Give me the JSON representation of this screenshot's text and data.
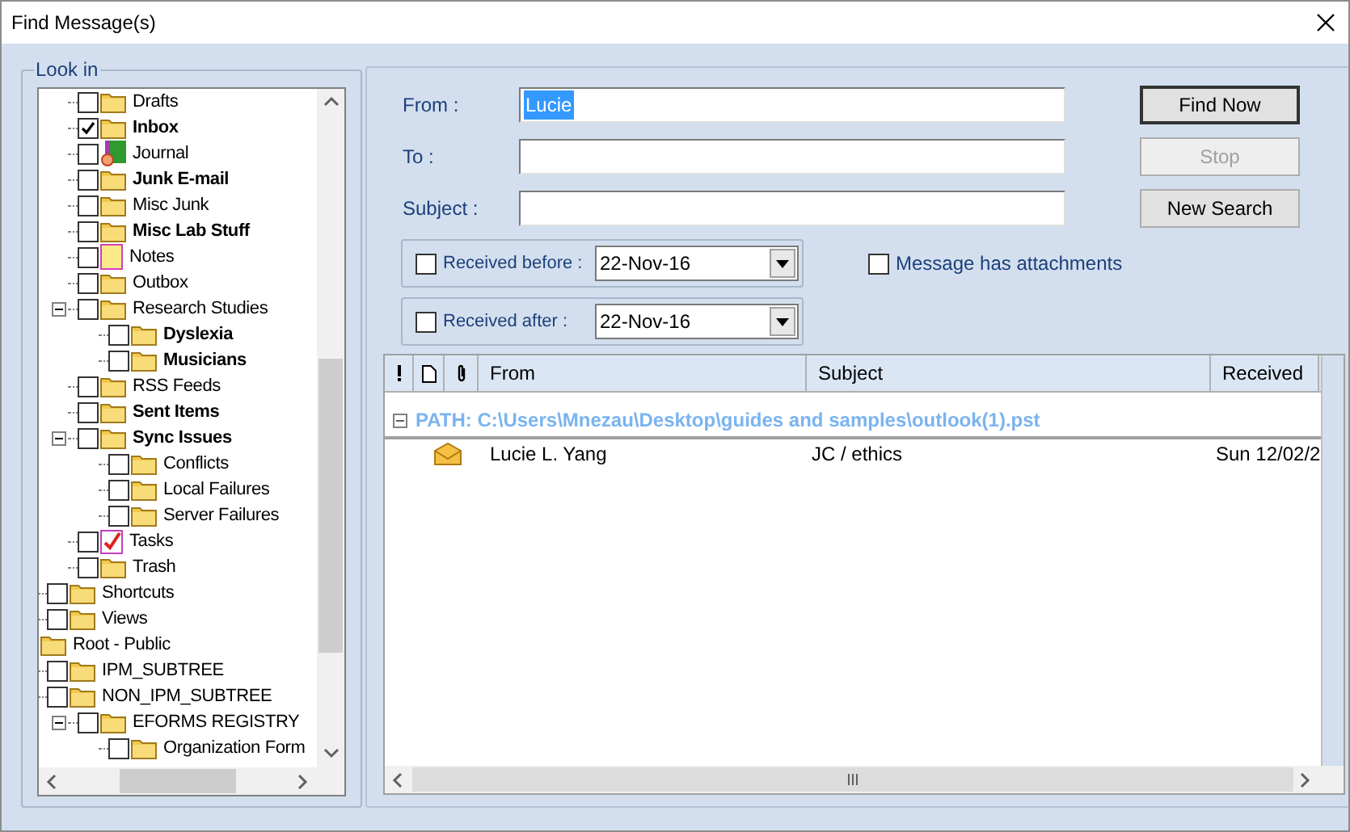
{
  "window": {
    "title": "Find Message(s)"
  },
  "look_in": {
    "label": "Look in",
    "tree": [
      {
        "children": [
          {
            "children": [
              {
                "label": "Drafts",
                "checkbox": true,
                "checked": false,
                "bold": false,
                "kind": "folder"
              },
              {
                "label": "Inbox",
                "checkbox": true,
                "checked": true,
                "bold": true,
                "kind": "folder"
              },
              {
                "label": "Journal",
                "checkbox": true,
                "checked": false,
                "bold": false,
                "kind": "journal"
              },
              {
                "label": "Junk E-mail",
                "checkbox": true,
                "checked": false,
                "bold": true,
                "kind": "folder"
              },
              {
                "label": "Misc Junk",
                "checkbox": true,
                "checked": false,
                "bold": false,
                "kind": "folder"
              },
              {
                "label": "Misc Lab Stuff",
                "checkbox": true,
                "checked": false,
                "bold": true,
                "kind": "folder"
              },
              {
                "label": "Notes",
                "checkbox": true,
                "checked": false,
                "bold": false,
                "kind": "notes"
              },
              {
                "label": "Outbox",
                "checkbox": true,
                "checked": false,
                "bold": false,
                "kind": "folder"
              },
              {
                "label": "Research Studies",
                "checkbox": true,
                "checked": false,
                "bold": false,
                "kind": "folder",
                "expanded": true,
                "children": [
                  {
                    "label": "Dyslexia",
                    "checkbox": true,
                    "checked": false,
                    "bold": true,
                    "kind": "folder"
                  },
                  {
                    "label": "Musicians",
                    "checkbox": true,
                    "checked": false,
                    "bold": true,
                    "kind": "folder"
                  }
                ]
              },
              {
                "label": "RSS Feeds",
                "checkbox": true,
                "checked": false,
                "bold": false,
                "kind": "folder"
              },
              {
                "label": "Sent Items",
                "checkbox": true,
                "checked": false,
                "bold": true,
                "kind": "folder"
              },
              {
                "label": "Sync Issues",
                "checkbox": true,
                "checked": false,
                "bold": true,
                "kind": "folder",
                "expanded": true,
                "children": [
                  {
                    "label": "Conflicts",
                    "checkbox": true,
                    "checked": false,
                    "bold": false,
                    "kind": "folder"
                  },
                  {
                    "label": "Local Failures",
                    "checkbox": true,
                    "checked": false,
                    "bold": false,
                    "kind": "folder"
                  },
                  {
                    "label": "Server Failures",
                    "checkbox": true,
                    "checked": false,
                    "bold": false,
                    "kind": "folder"
                  }
                ]
              },
              {
                "label": "Tasks",
                "checkbox": true,
                "checked": false,
                "bold": false,
                "kind": "tasks"
              },
              {
                "label": "Trash",
                "checkbox": true,
                "checked": false,
                "bold": false,
                "kind": "folder"
              }
            ]
          },
          {
            "label": "Shortcuts",
            "checkbox": true,
            "checked": false,
            "bold": false,
            "kind": "folder"
          },
          {
            "label": "Views",
            "checkbox": true,
            "checked": false,
            "bold": false,
            "kind": "folder"
          }
        ]
      },
      {
        "label": "Root - Public",
        "checkbox": false,
        "bold": false,
        "kind": "folder",
        "children": [
          {
            "label": "IPM_SUBTREE",
            "checkbox": true,
            "checked": false,
            "bold": false,
            "kind": "folder"
          },
          {
            "label": "NON_IPM_SUBTREE",
            "checkbox": true,
            "checked": false,
            "bold": false,
            "kind": "folder",
            "children": [
              {
                "label": "EFORMS REGISTRY",
                "checkbox": true,
                "checked": false,
                "bold": false,
                "kind": "folder",
                "expanded": true,
                "children": [
                  {
                    "label": "Organization Form",
                    "checkbox": true,
                    "checked": false,
                    "bold": false,
                    "kind": "folder"
                  }
                ]
              }
            ]
          }
        ]
      }
    ]
  },
  "fields": [
    {
      "label": "From :",
      "value": "Lucie",
      "selected": true
    },
    {
      "label": "To :"
    },
    {
      "label": "Subject :"
    }
  ],
  "buttons": [
    {
      "label": "Find Now",
      "disabled": false,
      "default": true
    },
    {
      "label": "Stop",
      "disabled": true,
      "default": false
    },
    {
      "label": "New Search",
      "disabled": false,
      "default": false
    }
  ],
  "date_filters": [
    {
      "label": "Received before :",
      "checked": false,
      "value": "22-Nov-16"
    },
    {
      "label": "Received after :",
      "checked": false,
      "value": "22-Nov-16"
    }
  ],
  "attachments": {
    "label": "Message has attachments",
    "checked": false
  },
  "results": {
    "columns": [
      {
        "kind": "importance"
      },
      {
        "kind": "type"
      },
      {
        "kind": "attachment"
      },
      {
        "kind": "text",
        "label": "From"
      },
      {
        "kind": "text",
        "label": "Subject"
      },
      {
        "kind": "text",
        "label": "Received"
      }
    ],
    "groups": [
      {
        "label": "PATH: C:\\Users\\Mnezau\\Desktop\\guides and samples\\outlook(1).pst",
        "expanded": true,
        "rows": [
          {
            "from": "Lucie L. Yang",
            "subject": "JC / ethics",
            "received": "Sun 12/02/2"
          }
        ]
      }
    ]
  }
}
